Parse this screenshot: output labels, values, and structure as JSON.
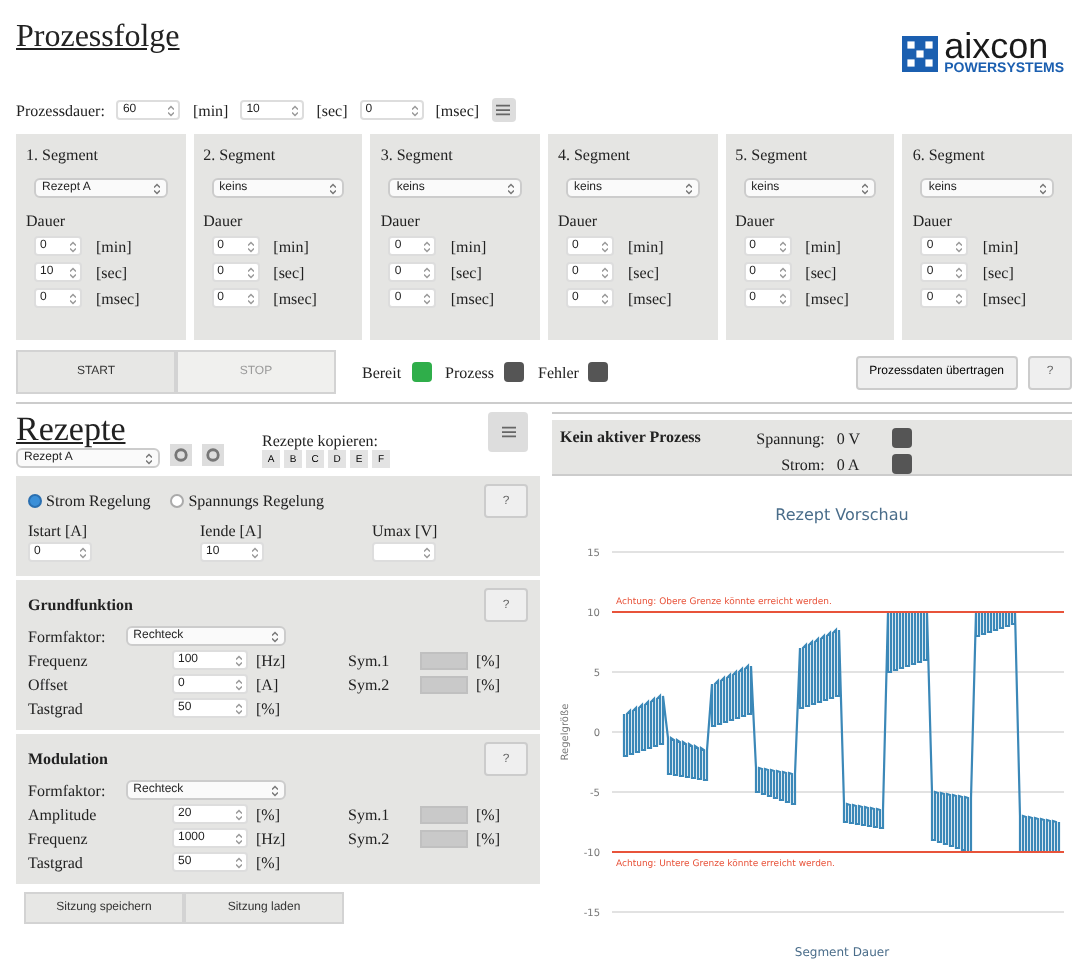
{
  "header": {
    "title": "Prozessfolge",
    "logo": {
      "name": "aixcon",
      "tagline": "POWERSYSTEMS"
    }
  },
  "duration": {
    "label": "Prozessdauer:",
    "fields": [
      {
        "value": "60",
        "unit": "[min]"
      },
      {
        "value": "10",
        "unit": "[sec]"
      },
      {
        "value": "0",
        "unit": "[msec]"
      }
    ]
  },
  "segments": [
    {
      "title": "1. Segment",
      "recipe": "Rezept A",
      "duration_label": "Dauer",
      "fields": [
        {
          "value": "0",
          "unit": "[min]"
        },
        {
          "value": "10",
          "unit": "[sec]"
        },
        {
          "value": "0",
          "unit": "[msec]"
        }
      ]
    },
    {
      "title": "2. Segment",
      "recipe": "keins",
      "duration_label": "Dauer",
      "fields": [
        {
          "value": "0",
          "unit": "[min]"
        },
        {
          "value": "0",
          "unit": "[sec]"
        },
        {
          "value": "0",
          "unit": "[msec]"
        }
      ]
    },
    {
      "title": "3. Segment",
      "recipe": "keins",
      "duration_label": "Dauer",
      "fields": [
        {
          "value": "0",
          "unit": "[min]"
        },
        {
          "value": "0",
          "unit": "[sec]"
        },
        {
          "value": "0",
          "unit": "[msec]"
        }
      ]
    },
    {
      "title": "4. Segment",
      "recipe": "keins",
      "duration_label": "Dauer",
      "fields": [
        {
          "value": "0",
          "unit": "[min]"
        },
        {
          "value": "0",
          "unit": "[sec]"
        },
        {
          "value": "0",
          "unit": "[msec]"
        }
      ]
    },
    {
      "title": "5. Segment",
      "recipe": "keins",
      "duration_label": "Dauer",
      "fields": [
        {
          "value": "0",
          "unit": "[min]"
        },
        {
          "value": "0",
          "unit": "[sec]"
        },
        {
          "value": "0",
          "unit": "[msec]"
        }
      ]
    },
    {
      "title": "6. Segment",
      "recipe": "keins",
      "duration_label": "Dauer",
      "fields": [
        {
          "value": "0",
          "unit": "[min]"
        },
        {
          "value": "0",
          "unit": "[sec]"
        },
        {
          "value": "0",
          "unit": "[msec]"
        }
      ]
    }
  ],
  "controls": {
    "buttons": [
      {
        "label": "START",
        "disabled": false
      },
      {
        "label": "STOP",
        "disabled": true
      }
    ],
    "indicators": [
      {
        "label": "Bereit",
        "color": "#2fae4a"
      },
      {
        "label": "Prozess",
        "color": "#555555"
      },
      {
        "label": "Fehler",
        "color": "#555555"
      }
    ],
    "transfer": "Prozessdaten übertragen",
    "help": "?"
  },
  "recipes": {
    "title": "Rezepte",
    "selected_recipe": "Rezept A",
    "copy_label": "Rezepte kopieren:",
    "copy_targets": [
      "A",
      "B",
      "C",
      "D",
      "E",
      "F"
    ],
    "modes": [
      {
        "label": "Strom Regelung",
        "selected": true
      },
      {
        "label": "Spannungs Regelung",
        "selected": false
      }
    ],
    "mode_help": "?",
    "params": [
      {
        "label": "Istart [A]",
        "value": "0"
      },
      {
        "label": "Iende [A]",
        "value": "10"
      },
      {
        "label": "Umax [V]"
      }
    ],
    "sections": [
      {
        "title": "Grundfunktion",
        "help": "?",
        "form_label": "Formfaktor:",
        "form": "Rechteck",
        "rows": [
          {
            "label": "Frequenz",
            "value": "100",
            "unit": "[Hz]"
          },
          {
            "label": "Offset",
            "value": "0",
            "unit": "[A]"
          },
          {
            "label": "Tastgrad",
            "value": "50",
            "unit": "[%]"
          }
        ],
        "sym": [
          {
            "label": "Sym.1",
            "unit": "[%]",
            "disabled": true
          },
          {
            "label": "Sym.2",
            "unit": "[%]",
            "disabled": true
          }
        ]
      },
      {
        "title": "Modulation",
        "help": "?",
        "form_label": "Formfaktor:",
        "form": "Rechteck",
        "rows": [
          {
            "label": "Amplitude",
            "value": "20",
            "unit": "[%]"
          },
          {
            "label": "Frequenz",
            "value": "1000",
            "unit": "[Hz]"
          },
          {
            "label": "Tastgrad",
            "value": "50",
            "unit": "[%]"
          }
        ],
        "sym": [
          {
            "label": "Sym.1",
            "unit": "[%]",
            "disabled": true
          },
          {
            "label": "Sym.2",
            "unit": "[%]",
            "disabled": true
          }
        ]
      }
    ],
    "session_buttons": [
      "Sitzung speichern",
      "Sitzung laden"
    ]
  },
  "status": {
    "process": "Kein aktiver Prozess",
    "readings": [
      {
        "label": "Spannung:",
        "value": "0 V",
        "color": "#555555"
      },
      {
        "label": "Strom:",
        "value": "0 A",
        "color": "#555555"
      }
    ]
  },
  "preview": {
    "title": "Rezept Vorschau",
    "yticks": [
      "15",
      "10",
      "5",
      "0",
      "-5",
      "-10",
      "-15"
    ],
    "upper_warning": "Achtung: Obere Grenze könnte erreicht werden.",
    "lower_warning": "Achtung: Untere Grenze könnte erreicht werden.",
    "ylabel": "Regelgröße",
    "xlabel": "Segment Dauer"
  }
}
